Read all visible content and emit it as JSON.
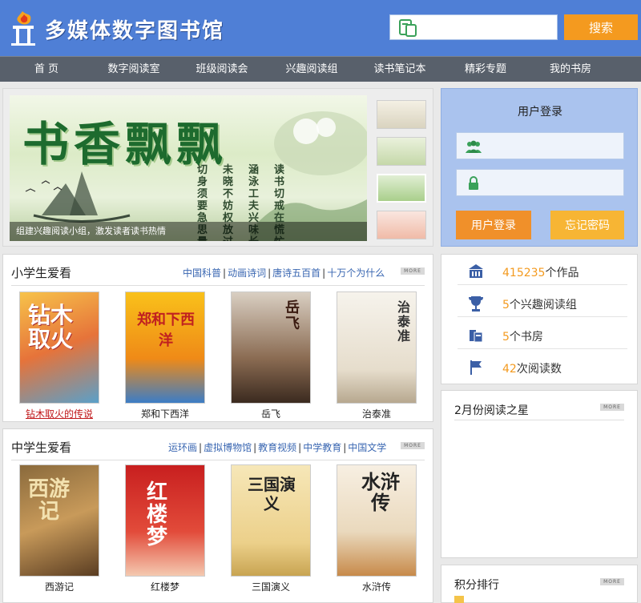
{
  "header": {
    "site_title": "多媒体数字图书馆",
    "search_placeholder": "",
    "search_button": "搜索",
    "logo_icon": "torch-logo-icon",
    "bg_color": "#4f7fd6"
  },
  "nav": {
    "items": [
      "首 页",
      "数字阅读室",
      "班级阅读会",
      "兴趣阅读组",
      "读书笔记本",
      "精彩专题",
      "我的书房"
    ]
  },
  "banner": {
    "title": "书香飘飘",
    "poem": [
      "读书切戒在慌忙",
      "涵泳工夫兴味长",
      "未晓不妨权放过",
      "切身须要急思量"
    ],
    "caption": "组建兴趣阅读小组，激发读者读书热情"
  },
  "login": {
    "title": "用户登录",
    "username_placeholder": "",
    "password_placeholder": "",
    "login_button": "用户登录",
    "forgot_button": "忘记密码"
  },
  "primary_section": {
    "title": "小学生爱看",
    "links": [
      "中国科普",
      "动画诗词",
      "唐诗五百首",
      "十万个为什么"
    ],
    "more": "MORE",
    "books": [
      {
        "title": "钻木取火的传说",
        "cover_text": "钻木取火",
        "linked": true
      },
      {
        "title": "郑和下西洋",
        "cover_text": "郑和下西洋",
        "linked": false
      },
      {
        "title": "岳飞",
        "cover_text": "岳飞",
        "linked": false
      },
      {
        "title": "治泰准",
        "cover_text": "治泰准",
        "linked": false
      }
    ]
  },
  "middle_section": {
    "title": "中学生爱看",
    "links": [
      "运环画",
      "虚拟博物馆",
      "教育视频",
      "中学教育",
      "中国文学"
    ],
    "more": "MORE",
    "books": [
      {
        "title": "西游记",
        "cover_text": "西游记"
      },
      {
        "title": "红楼梦",
        "cover_text": "红楼梦"
      },
      {
        "title": "三国演义",
        "cover_text": "三国演义"
      },
      {
        "title": "水浒传",
        "cover_text": "水浒传"
      }
    ]
  },
  "stats": [
    {
      "icon": "library-icon",
      "number": "415235",
      "label": "个作品"
    },
    {
      "icon": "trophy-icon",
      "number": "5",
      "label": "个兴趣阅读组"
    },
    {
      "icon": "bookshelf-icon",
      "number": "5",
      "label": "个书房"
    },
    {
      "icon": "flag-icon",
      "number": "42",
      "label": "次阅读数"
    }
  ],
  "reading_star": {
    "title": "2月份阅读之星",
    "more": "MORE"
  },
  "points_rank": {
    "title": "积分排行",
    "more": "MORE"
  }
}
